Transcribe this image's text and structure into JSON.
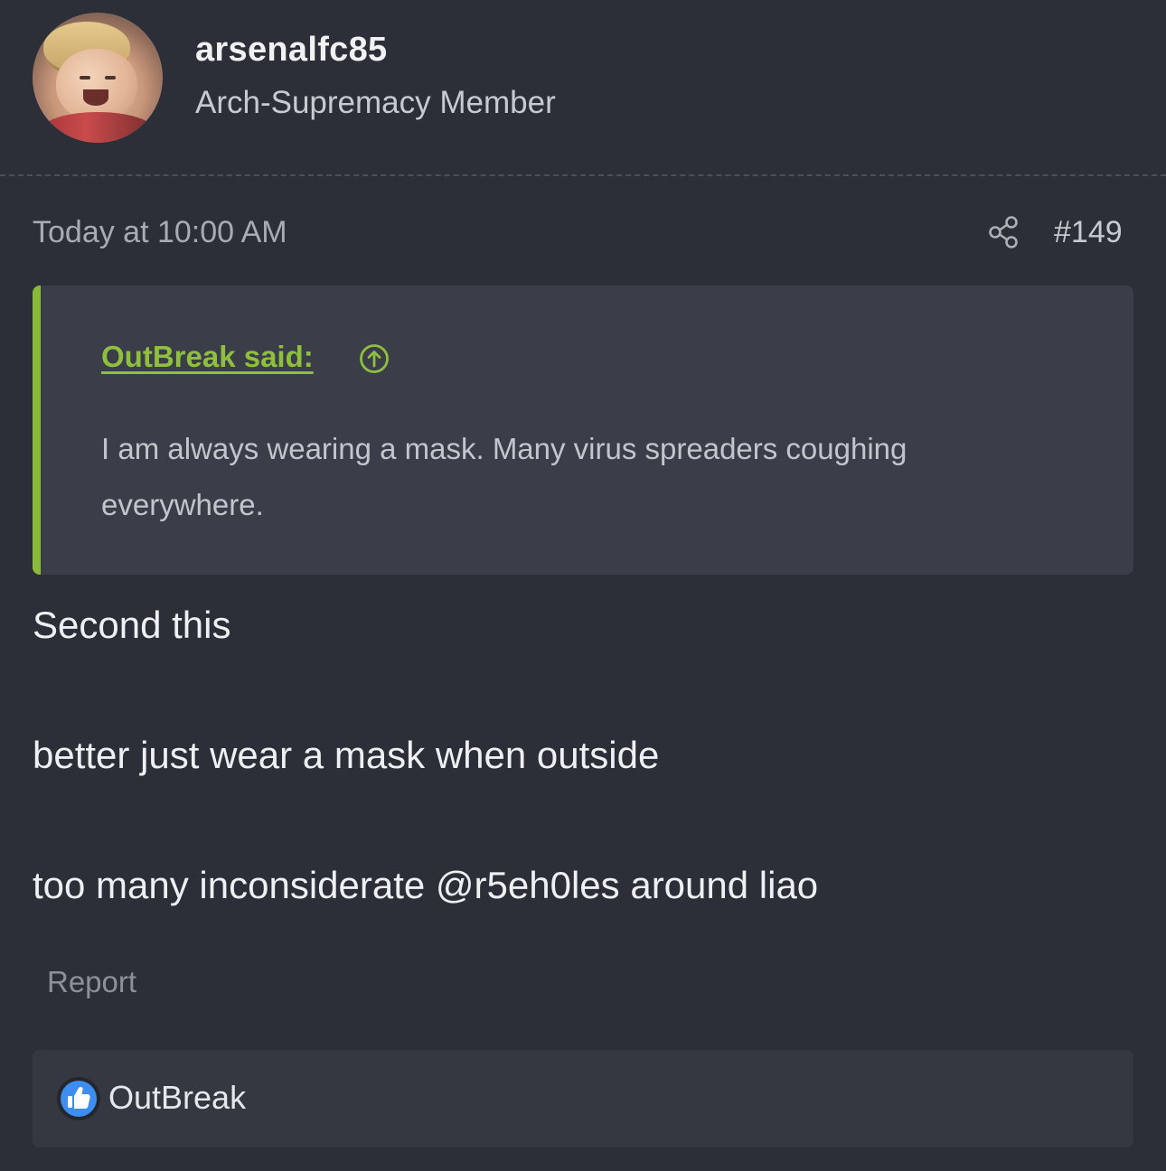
{
  "user": {
    "username": "arsenalfc85",
    "title": "Arch-Supremacy Member",
    "avatar_icon": "avatar-image"
  },
  "post": {
    "timestamp": "Today at 10:00 AM",
    "share_icon": "share-icon",
    "number": "#149"
  },
  "quote": {
    "author": "OutBreak said:",
    "jump_icon": "arrow-up-circle-icon",
    "text": "I am always wearing a mask. Many virus spreaders coughing everywhere.",
    "accent_color": "#8aba3a"
  },
  "body": {
    "lines": [
      "Second this",
      "better just wear a mask when outside",
      "too many inconsiderate @r5eh0les around liao"
    ]
  },
  "actions": {
    "report_label": "Report"
  },
  "reactions": {
    "icon": "thumbs-up-icon",
    "icon_color": "#3d8ef0",
    "users": "OutBreak"
  },
  "colors": {
    "background": "#2c2f38",
    "quote_background": "#3b3e48",
    "reaction_background": "#353841"
  }
}
